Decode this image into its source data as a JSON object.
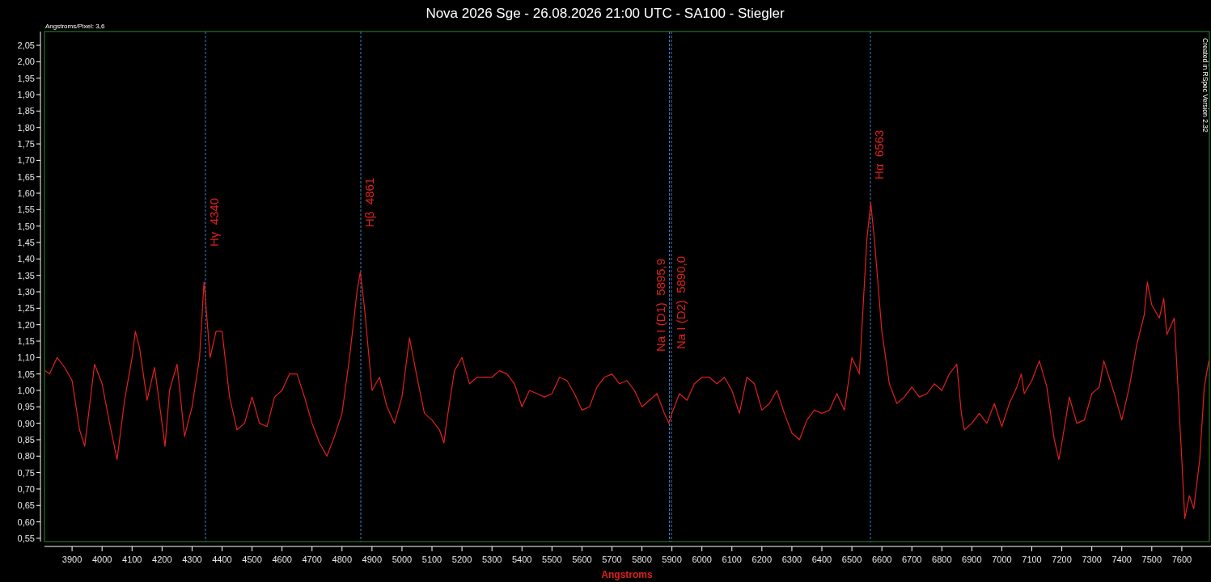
{
  "chart_note": "Angstroms/Pixel: 3,6",
  "credit": "Created in RSpec Version 2.32",
  "chart_data": {
    "type": "line",
    "title": "Nova 2026 Sge - 26.08.2026 21:00 UTC - SA100 - Stiegler",
    "xlabel": "Angstroms",
    "x": [
      3810,
      3825,
      3850,
      3875,
      3900,
      3925,
      3942,
      3975,
      4000,
      4025,
      4050,
      4075,
      4100,
      4111,
      4125,
      4150,
      4175,
      4200,
      4210,
      4225,
      4250,
      4275,
      4300,
      4325,
      4340,
      4360,
      4380,
      4400,
      4425,
      4450,
      4475,
      4500,
      4525,
      4550,
      4575,
      4600,
      4625,
      4650,
      4675,
      4700,
      4725,
      4750,
      4775,
      4800,
      4825,
      4850,
      4861,
      4875,
      4900,
      4925,
      4950,
      4975,
      5000,
      5025,
      5050,
      5075,
      5100,
      5125,
      5140,
      5150,
      5175,
      5200,
      5225,
      5250,
      5275,
      5300,
      5325,
      5350,
      5375,
      5400,
      5425,
      5450,
      5475,
      5500,
      5525,
      5550,
      5575,
      5600,
      5625,
      5650,
      5675,
      5700,
      5725,
      5750,
      5775,
      5800,
      5825,
      5850,
      5875,
      5890,
      5900,
      5925,
      5950,
      5975,
      6000,
      6025,
      6050,
      6075,
      6100,
      6125,
      6150,
      6175,
      6200,
      6225,
      6250,
      6275,
      6300,
      6325,
      6350,
      6375,
      6400,
      6425,
      6450,
      6475,
      6500,
      6525,
      6550,
      6563,
      6575,
      6600,
      6625,
      6650,
      6675,
      6700,
      6725,
      6750,
      6775,
      6800,
      6825,
      6850,
      6865,
      6875,
      6900,
      6925,
      6950,
      6975,
      7000,
      7025,
      7050,
      7065,
      7075,
      7100,
      7125,
      7150,
      7175,
      7190,
      7200,
      7225,
      7250,
      7275,
      7300,
      7325,
      7340,
      7375,
      7400,
      7425,
      7450,
      7475,
      7485,
      7500,
      7525,
      7540,
      7550,
      7575,
      7600,
      7610,
      7625,
      7640,
      7660,
      7675,
      7690
    ],
    "series": [
      {
        "color": "#e0201e",
        "values": [
          1.06,
          1.05,
          1.1,
          1.07,
          1.03,
          0.88,
          0.83,
          1.08,
          1.02,
          0.9,
          0.79,
          0.97,
          1.1,
          1.18,
          1.13,
          0.97,
          1.07,
          0.9,
          0.83,
          1.0,
          1.08,
          0.86,
          0.95,
          1.1,
          1.33,
          1.1,
          1.18,
          1.18,
          0.98,
          0.88,
          0.9,
          0.98,
          0.9,
          0.89,
          0.98,
          1.0,
          1.05,
          1.05,
          0.98,
          0.9,
          0.84,
          0.8,
          0.86,
          0.93,
          1.1,
          1.3,
          1.36,
          1.25,
          1.0,
          1.04,
          0.95,
          0.9,
          0.98,
          1.16,
          1.04,
          0.93,
          0.91,
          0.88,
          0.84,
          0.91,
          1.06,
          1.1,
          1.02,
          1.04,
          1.04,
          1.04,
          1.06,
          1.05,
          1.02,
          0.95,
          1.0,
          0.99,
          0.98,
          0.99,
          1.04,
          1.03,
          0.99,
          0.94,
          0.95,
          1.01,
          1.04,
          1.05,
          1.02,
          1.03,
          1.0,
          0.95,
          0.97,
          0.99,
          0.93,
          0.9,
          0.93,
          0.99,
          0.97,
          1.02,
          1.04,
          1.04,
          1.02,
          1.04,
          1.0,
          0.93,
          1.04,
          1.02,
          0.94,
          0.96,
          1.0,
          0.93,
          0.87,
          0.85,
          0.91,
          0.94,
          0.93,
          0.94,
          0.99,
          0.94,
          1.1,
          1.05,
          1.46,
          1.57,
          1.46,
          1.18,
          1.02,
          0.96,
          0.98,
          1.01,
          0.98,
          0.99,
          1.02,
          1.0,
          1.05,
          1.08,
          0.93,
          0.88,
          0.9,
          0.93,
          0.9,
          0.96,
          0.89,
          0.96,
          1.01,
          1.05,
          0.99,
          1.03,
          1.09,
          1.01,
          0.85,
          0.79,
          0.84,
          0.98,
          0.9,
          0.91,
          0.99,
          1.01,
          1.09,
          0.99,
          0.91,
          1.01,
          1.14,
          1.23,
          1.33,
          1.26,
          1.22,
          1.28,
          1.17,
          1.22,
          0.79,
          0.61,
          0.68,
          0.64,
          0.79,
          1.01,
          1.09
        ]
      }
    ],
    "xlim": [
      3808,
      7692
    ],
    "ylim": [
      0.54,
      2.092
    ],
    "xticks": [
      3900,
      4000,
      4100,
      4200,
      4300,
      4400,
      4500,
      4600,
      4700,
      4800,
      4900,
      5000,
      5100,
      5200,
      5300,
      5400,
      5500,
      5600,
      5700,
      5800,
      5900,
      6000,
      6100,
      6200,
      6300,
      6400,
      6500,
      6600,
      6700,
      6800,
      6900,
      7000,
      7100,
      7200,
      7300,
      7400,
      7500,
      7600
    ],
    "yticks": [
      {
        "value": 0.55,
        "label": "0,55"
      },
      {
        "value": 0.6,
        "label": "0,60"
      },
      {
        "value": 0.65,
        "label": "0,65"
      },
      {
        "value": 0.7,
        "label": "0,70"
      },
      {
        "value": 0.75,
        "label": "0,75"
      },
      {
        "value": 0.8,
        "label": "0,80"
      },
      {
        "value": 0.85,
        "label": "0,85"
      },
      {
        "value": 0.9,
        "label": "0,90"
      },
      {
        "value": 0.95,
        "label": "0,95"
      },
      {
        "value": 1.0,
        "label": "1,00"
      },
      {
        "value": 1.05,
        "label": "1,05"
      },
      {
        "value": 1.1,
        "label": "1,10"
      },
      {
        "value": 1.15,
        "label": "1,15"
      },
      {
        "value": 1.2,
        "label": "1,20"
      },
      {
        "value": 1.25,
        "label": "1,25"
      },
      {
        "value": 1.3,
        "label": "1,30"
      },
      {
        "value": 1.35,
        "label": "1,35"
      },
      {
        "value": 1.4,
        "label": "1,40"
      },
      {
        "value": 1.45,
        "label": "1,45"
      },
      {
        "value": 1.5,
        "label": "1,50"
      },
      {
        "value": 1.55,
        "label": "1,55"
      },
      {
        "value": 1.6,
        "label": "1,60"
      },
      {
        "value": 1.65,
        "label": "1,65"
      },
      {
        "value": 1.7,
        "label": "1,70"
      },
      {
        "value": 1.75,
        "label": "1,75"
      },
      {
        "value": 1.8,
        "label": "1,80"
      },
      {
        "value": 1.85,
        "label": "1,85"
      },
      {
        "value": 1.9,
        "label": "1,90"
      },
      {
        "value": 1.95,
        "label": "1,95"
      },
      {
        "value": 2.0,
        "label": "2,00"
      },
      {
        "value": 2.05,
        "label": "2,05"
      }
    ],
    "annotations": [
      "Hγ  4340",
      "Hβ  4861",
      "Na I (D1)  5895,9",
      "Na I (D2)  5890,0",
      "Hα  6563"
    ]
  }
}
